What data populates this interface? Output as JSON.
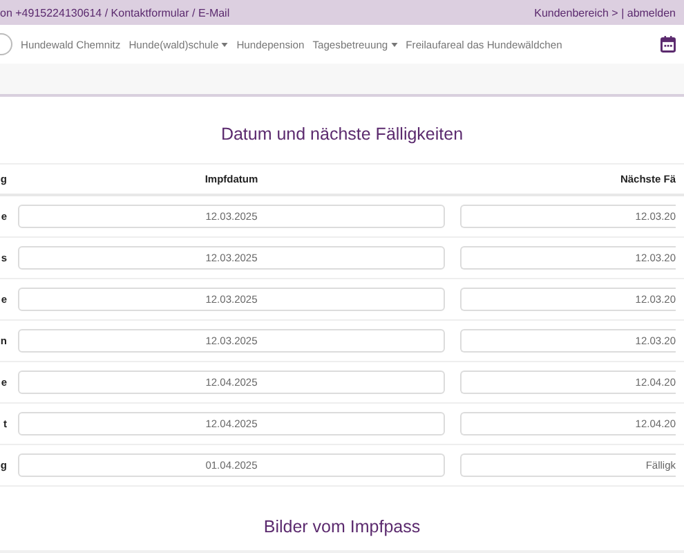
{
  "top_bar": {
    "contact": "on +4915224130614 / Kontaktformular / E-Mail",
    "account": "Kundenbereich > | abmelden"
  },
  "nav": {
    "items": [
      {
        "label": "Hundewald Chemnitz",
        "dropdown": false
      },
      {
        "label": "Hunde(wald)schule",
        "dropdown": true
      },
      {
        "label": "Hundepension",
        "dropdown": false
      },
      {
        "label": "Tagesbetreuung",
        "dropdown": true
      },
      {
        "label": "Freilaufareal das Hundewäldchen",
        "dropdown": false
      }
    ]
  },
  "section_title": "Datum und nächste Fälligkeiten",
  "table": {
    "columns": [
      "g",
      "Impfdatum",
      "Nächste Fä"
    ],
    "rows": [
      {
        "label": "e",
        "date": "12.03.2025",
        "next": "12.03.20"
      },
      {
        "label": "s",
        "date": "12.03.2025",
        "next": "12.03.20"
      },
      {
        "label": "e",
        "date": "12.03.2025",
        "next": "12.03.20"
      },
      {
        "label": "n",
        "date": "12.03.2025",
        "next": "12.03.20"
      },
      {
        "label": "e",
        "date": "12.04.2025",
        "next": "12.04.20"
      },
      {
        "label": "t",
        "date": "12.04.2025",
        "next": "12.04.20"
      },
      {
        "label": "g",
        "date": "01.04.2025",
        "next": "Fälligk"
      }
    ]
  },
  "images_title": "Bilder vom Impfpass"
}
